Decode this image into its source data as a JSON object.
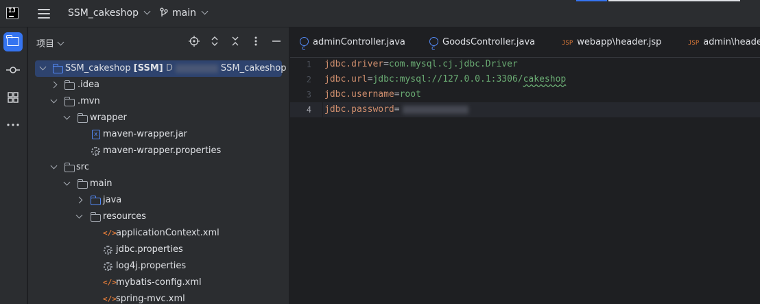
{
  "titlebar": {
    "project": "SSM_cakeshop",
    "branch": "main"
  },
  "panel": {
    "title": "项目"
  },
  "tree": {
    "root_name": "SSM_cakeshop",
    "root_module": "[SSM]",
    "root_path_prefix": "D",
    "root_path_suffix": "SSM_cakeshop",
    "items": [
      {
        "label": ".idea"
      },
      {
        "label": ".mvn"
      },
      {
        "label": "wrapper"
      },
      {
        "label": "maven-wrapper.jar"
      },
      {
        "label": "maven-wrapper.properties"
      },
      {
        "label": "src"
      },
      {
        "label": "main"
      },
      {
        "label": "java"
      },
      {
        "label": "resources"
      },
      {
        "label": "applicationContext.xml"
      },
      {
        "label": "jdbc.properties"
      },
      {
        "label": "log4j.properties"
      },
      {
        "label": "mybatis-config.xml"
      },
      {
        "label": "spring-mvc.xml"
      }
    ]
  },
  "tabs": [
    {
      "label": "adminController.java",
      "icon": "class-icon"
    },
    {
      "label": "GoodsController.java",
      "icon": "class-icon"
    },
    {
      "label": "webapp\\header.jsp",
      "icon": "jsp-icon"
    },
    {
      "label": "admin\\header",
      "icon": "jsp-icon"
    }
  ],
  "icons": {
    "jsp": "JSP"
  },
  "editor": {
    "line_numbers": [
      "1",
      "2",
      "3",
      "4"
    ],
    "lines": [
      {
        "key": "jdbc.driver",
        "eq": "=",
        "value": "com.mysql.cj.jdbc.Driver"
      },
      {
        "key": "jdbc.url",
        "eq": "=",
        "value_a": "jdbc:mysql://127.0.0.1:3306/",
        "value_b": "cakeshop"
      },
      {
        "key": "jdbc.username",
        "eq": "=",
        "value": "root"
      },
      {
        "key": "jdbc.password",
        "eq": "=",
        "value": ""
      }
    ]
  },
  "colors": {
    "accent": "#3574f0",
    "key": "#cf8e6d",
    "value": "#6aab73"
  }
}
